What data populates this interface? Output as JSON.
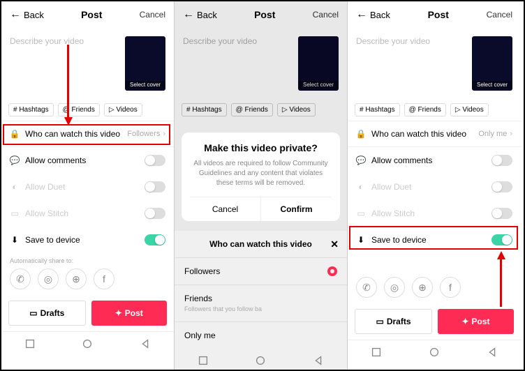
{
  "header": {
    "back": "Back",
    "title": "Post",
    "cancel": "Cancel"
  },
  "describe": {
    "placeholder": "Describe your video",
    "cover": "Select cover"
  },
  "chips": {
    "hashtags": "# Hashtags",
    "friends": "@ Friends",
    "videos": "▷ Videos"
  },
  "privacy": {
    "label": "Who can watch this video",
    "value_followers": "Followers",
    "value_onlyme": "Only me"
  },
  "settings": {
    "comments": "Allow comments",
    "duet": "Allow Duet",
    "stitch": "Allow Stitch",
    "save": "Save to device"
  },
  "share": {
    "auto": "Automatically share to:"
  },
  "buttons": {
    "drafts": "Drafts",
    "post": "Post"
  },
  "modal": {
    "title": "Make this video private?",
    "text": "All videos are required to follow Community Guidelines and any content that violates these terms will be removed.",
    "cancel": "Cancel",
    "confirm": "Confirm"
  },
  "sheet": {
    "title": "Who can watch this video",
    "followers": "Followers",
    "friends": "Friends",
    "friends_sub": "Followers that you follow ba",
    "onlyme": "Only me"
  }
}
